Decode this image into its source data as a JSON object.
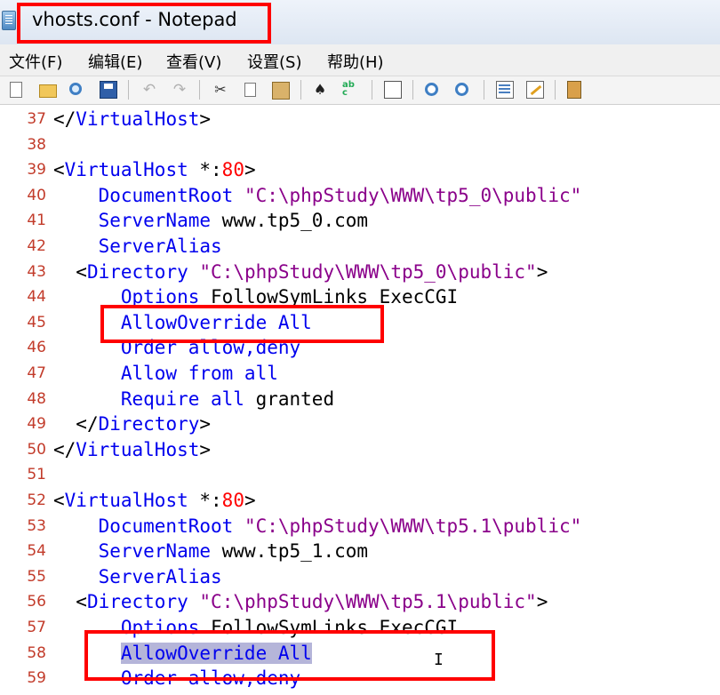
{
  "window": {
    "title": "vhosts.conf - Notepad"
  },
  "menu": [
    {
      "label": "文件(F)"
    },
    {
      "label": "编辑(E)"
    },
    {
      "label": "查看(V)"
    },
    {
      "label": "设置(S)"
    },
    {
      "label": "帮助(H)"
    }
  ],
  "toolbar": {
    "icons": [
      "new-file-icon",
      "open-folder-icon",
      "find-in-files-icon",
      "save-icon",
      "undo-icon",
      "redo-icon",
      "cut-icon",
      "copy-icon",
      "paste-icon",
      "find-icon",
      "spellcheck-icon",
      "word-wrap-icon",
      "zoom-in-icon",
      "zoom-out-icon",
      "line-numbers-icon",
      "edit-icon",
      "exit-icon"
    ]
  },
  "editor": {
    "lines": [
      {
        "n": "37",
        "tokens": [
          [
            "brk",
            "</"
          ],
          [
            "tag",
            "VirtualHost"
          ],
          [
            "brk",
            ">"
          ]
        ]
      },
      {
        "n": "38",
        "tokens": []
      },
      {
        "n": "39",
        "tokens": [
          [
            "brk",
            "<"
          ],
          [
            "tag",
            "VirtualHost"
          ],
          [
            "val",
            " *:"
          ],
          [
            "num",
            "80"
          ],
          [
            "brk",
            ">"
          ]
        ]
      },
      {
        "n": "40",
        "tokens": [
          [
            "val",
            "    "
          ],
          [
            "dir",
            "DocumentRoot"
          ],
          [
            "val",
            " "
          ],
          [
            "str",
            "\"C:\\phpStudy\\WWW\\tp5_0\\public\""
          ]
        ]
      },
      {
        "n": "41",
        "tokens": [
          [
            "val",
            "    "
          ],
          [
            "dir",
            "ServerName"
          ],
          [
            "val",
            " www.tp5_0.com"
          ]
        ]
      },
      {
        "n": "42",
        "tokens": [
          [
            "val",
            "    "
          ],
          [
            "dir",
            "ServerAlias"
          ]
        ]
      },
      {
        "n": "43",
        "tokens": [
          [
            "val",
            "  "
          ],
          [
            "brk",
            "<"
          ],
          [
            "tag",
            "Directory"
          ],
          [
            "val",
            " "
          ],
          [
            "str",
            "\"C:\\phpStudy\\WWW\\tp5_0\\public\""
          ],
          [
            "brk",
            ">"
          ]
        ]
      },
      {
        "n": "44",
        "tokens": [
          [
            "val",
            "      "
          ],
          [
            "dir",
            "Options"
          ],
          [
            "val",
            " FollowSymLinks ExecCGI"
          ]
        ]
      },
      {
        "n": "45",
        "tokens": [
          [
            "val",
            "      "
          ],
          [
            "dir",
            "AllowOverride All"
          ]
        ]
      },
      {
        "n": "46",
        "tokens": [
          [
            "val",
            "      "
          ],
          [
            "dir",
            "Order allow,deny"
          ]
        ]
      },
      {
        "n": "47",
        "tokens": [
          [
            "val",
            "      "
          ],
          [
            "dir",
            "Allow from all"
          ]
        ]
      },
      {
        "n": "48",
        "tokens": [
          [
            "val",
            "      "
          ],
          [
            "dir",
            "Require all"
          ],
          [
            "val",
            " granted"
          ]
        ]
      },
      {
        "n": "49",
        "tokens": [
          [
            "val",
            "  "
          ],
          [
            "brk",
            "</"
          ],
          [
            "tag",
            "Directory"
          ],
          [
            "brk",
            ">"
          ]
        ]
      },
      {
        "n": "50",
        "tokens": [
          [
            "brk",
            "</"
          ],
          [
            "tag",
            "VirtualHost"
          ],
          [
            "brk",
            ">"
          ]
        ]
      },
      {
        "n": "51",
        "tokens": []
      },
      {
        "n": "52",
        "tokens": [
          [
            "brk",
            "<"
          ],
          [
            "tag",
            "VirtualHost"
          ],
          [
            "val",
            " *:"
          ],
          [
            "num",
            "80"
          ],
          [
            "brk",
            ">"
          ]
        ]
      },
      {
        "n": "53",
        "tokens": [
          [
            "val",
            "    "
          ],
          [
            "dir",
            "DocumentRoot"
          ],
          [
            "val",
            " "
          ],
          [
            "str",
            "\"C:\\phpStudy\\WWW\\tp5.1\\public\""
          ]
        ]
      },
      {
        "n": "54",
        "tokens": [
          [
            "val",
            "    "
          ],
          [
            "dir",
            "ServerName"
          ],
          [
            "val",
            " www.tp5_1.com"
          ]
        ]
      },
      {
        "n": "55",
        "tokens": [
          [
            "val",
            "    "
          ],
          [
            "dir",
            "ServerAlias"
          ]
        ]
      },
      {
        "n": "56",
        "tokens": [
          [
            "val",
            "  "
          ],
          [
            "brk",
            "<"
          ],
          [
            "tag",
            "Directory"
          ],
          [
            "val",
            " "
          ],
          [
            "str",
            "\"C:\\phpStudy\\WWW\\tp5.1\\public\""
          ],
          [
            "brk",
            ">"
          ]
        ]
      },
      {
        "n": "57",
        "tokens": [
          [
            "val",
            "      "
          ],
          [
            "dir",
            "Options"
          ],
          [
            "val",
            " FollowSymLinks ExecCGI"
          ]
        ]
      },
      {
        "n": "58",
        "tokens": [
          [
            "val",
            "      "
          ],
          [
            "sel",
            "AllowOverride All"
          ]
        ]
      },
      {
        "n": "59",
        "tokens": [
          [
            "val",
            "      "
          ],
          [
            "dir",
            "Order allow,deny"
          ]
        ]
      }
    ]
  },
  "colors": {
    "tag": "#0000ee",
    "string": "#8a008a",
    "number": "#ff0000",
    "line_number": "#c23b2a",
    "selection": "#b5b5d9",
    "annotation_box": "#ff0000"
  }
}
